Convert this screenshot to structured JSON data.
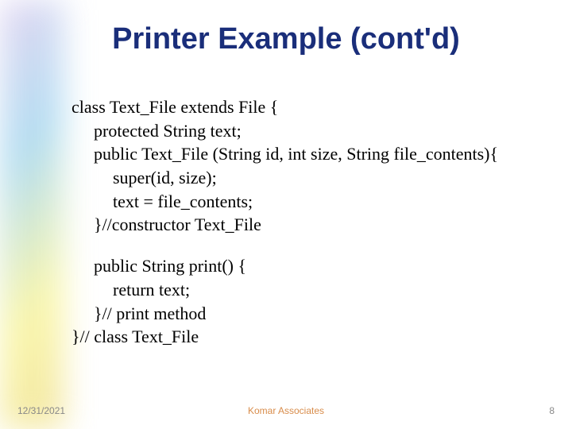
{
  "title": "Printer Example (cont'd)",
  "code": {
    "l1": "class Text_File extends File {",
    "l2": "protected String text;",
    "l3": "public Text_File (String id, int size, String file_contents){",
    "l4": "super(id, size);",
    "l5": "text = file_contents;",
    "l6": "}//constructor Text_File",
    "l7": "public String print() {",
    "l8": "return text;",
    "l9": "}// print method",
    "l10": "}// class Text_File"
  },
  "footer": {
    "date": "12/31/2021",
    "center": "Komar Associates",
    "page": "8"
  }
}
